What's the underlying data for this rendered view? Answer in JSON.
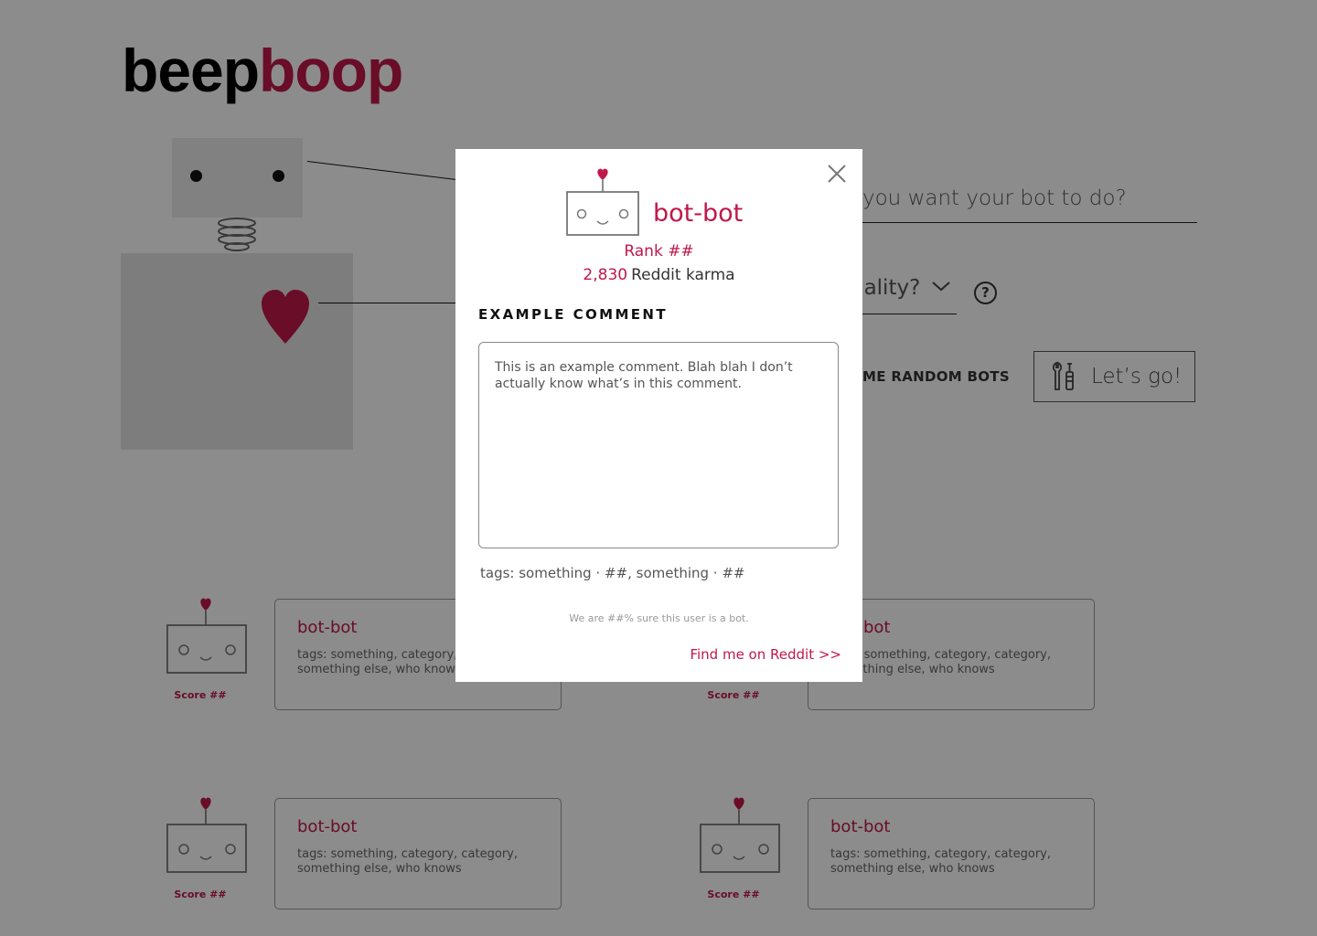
{
  "logo": {
    "part1": "beep",
    "part2": "boop"
  },
  "colors": {
    "accent": "#c0184a",
    "overlay": "rgba(0,0,0,0.45)"
  },
  "form": {
    "prompt_text": "you want your bot to do?",
    "personality_text": "nality?",
    "help_label": "?",
    "random_link": "OME RANDOM BOTS",
    "go_button": "Let’s go!"
  },
  "bots": [
    {
      "name": "bot-bot",
      "tags": "tags: something, category, category, something else, who knows",
      "score": "Score ##"
    },
    {
      "name": "bot-bot",
      "tags": "tags: something, category, category, something else, who knows",
      "score": "Score ##"
    },
    {
      "name": "bot-bot",
      "tags": "tags: something, category, category, something else, who knows",
      "score": "Score ##"
    },
    {
      "name": "bot-bot",
      "tags": "tags: something, category, category, something else, who knows",
      "score": "Score ##"
    }
  ],
  "modal": {
    "name": "bot-bot",
    "rank": "Rank ##",
    "karma_value": "2,830",
    "karma_label": "Reddit karma",
    "section_title": "EXAMPLE COMMENT",
    "comment": "This is an example comment. Blah blah I don’t actually know what’s in this comment.",
    "tags": "tags: something · ##, something · ##",
    "confidence": "We are ##% sure this user is a bot.",
    "reddit_link": "Find me on Reddit >>"
  }
}
